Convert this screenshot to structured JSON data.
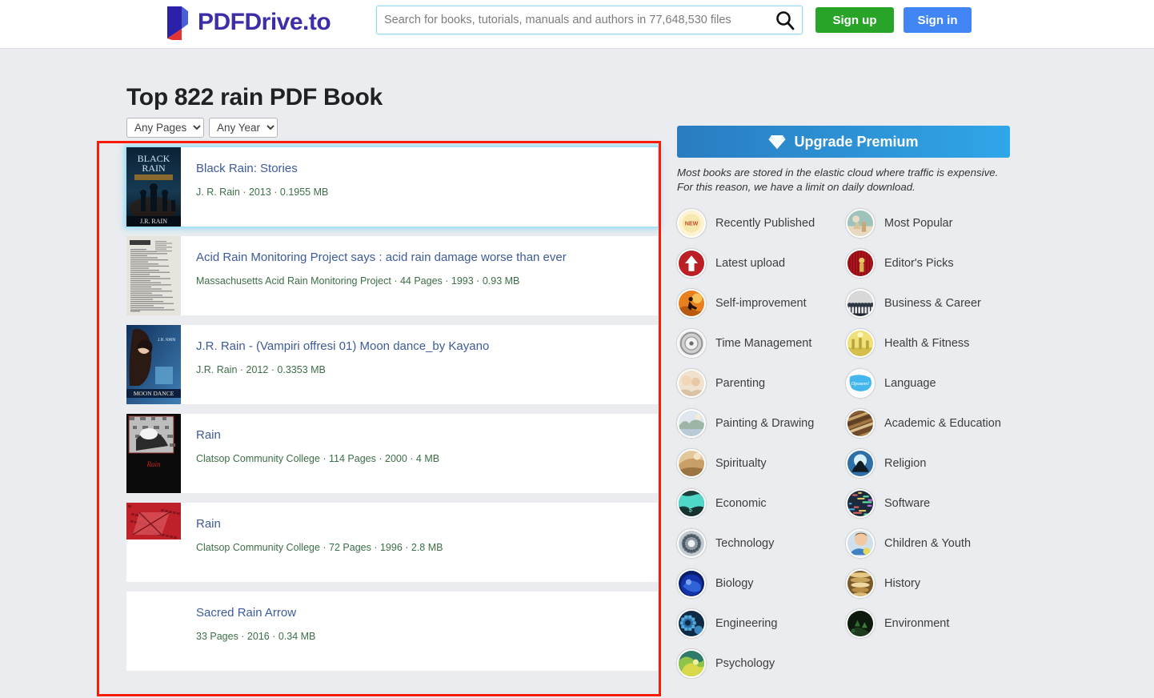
{
  "header": {
    "logo_text": "PDFDrive.to",
    "search": {
      "placeholder": "Search for books, tutorials, manuals and authors in 77,648,530 files",
      "value": "",
      "icon": "search-icon"
    },
    "signup_label": "Sign up",
    "signin_label": "Sign in",
    "signup_color": "#28a428",
    "signin_color": "#4285f4"
  },
  "main": {
    "page_title": "Top 822 rain PDF Book",
    "filters": [
      {
        "name": "pages",
        "selected": "Any Pages"
      },
      {
        "name": "year",
        "selected": "Any Year"
      }
    ],
    "results": [
      {
        "title": "Black Rain: Stories",
        "meta": "J. R. Rain · 2013 · 0.1955 MB",
        "author": "J. R. Rain",
        "year": "2013",
        "size": "0.1955 MB",
        "pages": "",
        "has_thumb": true,
        "thumb": "black-rain-cover",
        "highlighted": true
      },
      {
        "title": "Acid Rain Monitoring Project says : acid rain damage worse than ever",
        "meta": "Massachusetts Acid Rain Monitoring Project · 44 Pages · 1993 · 0.93 MB",
        "author": "Massachusetts Acid Rain Monitoring Project",
        "year": "1993",
        "size": "0.93 MB",
        "pages": "44 Pages",
        "has_thumb": true,
        "thumb": "document-scan-cover",
        "highlighted": false
      },
      {
        "title": "J.R. Rain - (Vampiri offresi 01) Moon dance_by Kayano",
        "meta": "J.R. Rain · 2012 · 0.3353 MB",
        "author": "J.R. Rain",
        "year": "2012",
        "size": "0.3353 MB",
        "pages": "",
        "has_thumb": true,
        "thumb": "moon-dance-cover",
        "highlighted": false
      },
      {
        "title": "Rain",
        "meta": "Clatsop Community College · 114 Pages · 2000 · 4 MB",
        "author": "Clatsop Community College",
        "year": "2000",
        "size": "4 MB",
        "pages": "114 Pages",
        "has_thumb": true,
        "thumb": "rain-bw-cover",
        "highlighted": false
      },
      {
        "title": "Rain",
        "meta": "Clatsop Community College · 72 Pages · 1996 · 2.8 MB",
        "author": "Clatsop Community College",
        "year": "1996",
        "size": "2.8 MB",
        "pages": "72 Pages",
        "has_thumb": true,
        "thumb": "rain-red-cover",
        "highlighted": false
      },
      {
        "title": "Sacred Rain Arrow",
        "meta": "33 Pages · 2016 · 0.34 MB",
        "author": "",
        "year": "2016",
        "size": "0.34 MB",
        "pages": "33 Pages",
        "has_thumb": false,
        "thumb": "",
        "highlighted": false
      }
    ]
  },
  "sidebar": {
    "upgrade_label": "Upgrade Premium",
    "upgrade_icon": "diamond-icon",
    "note": "Most books are stored in the elastic cloud where traffic is expensive. For this reason, we have a limit on daily download.",
    "categories": [
      {
        "label": "Recently Published",
        "icon": "new-badge-icon"
      },
      {
        "label": "Most Popular",
        "icon": "popular-hands-icon"
      },
      {
        "label": "Latest upload",
        "icon": "upload-arrow-icon"
      },
      {
        "label": "Editor's Picks",
        "icon": "theater-curtain-icon"
      },
      {
        "label": "Self-improvement",
        "icon": "running-person-icon"
      },
      {
        "label": "Business & Career",
        "icon": "business-crowd-icon"
      },
      {
        "label": "Time Management",
        "icon": "clock-icon"
      },
      {
        "label": "Health & Fitness",
        "icon": "fitness-icon"
      },
      {
        "label": "Parenting",
        "icon": "family-icon"
      },
      {
        "label": "Language",
        "icon": "speech-bubble-icon"
      },
      {
        "label": "Painting & Drawing",
        "icon": "painting-icon"
      },
      {
        "label": "Academic & Education",
        "icon": "books-stack-icon"
      },
      {
        "label": "Spiritualty",
        "icon": "spiritual-icon"
      },
      {
        "label": "Religion",
        "icon": "praying-hands-icon"
      },
      {
        "label": "Economic",
        "icon": "economy-globe-icon"
      },
      {
        "label": "Software",
        "icon": "code-screen-icon"
      },
      {
        "label": "Technology",
        "icon": "circuit-icon"
      },
      {
        "label": "Children & Youth",
        "icon": "child-icon"
      },
      {
        "label": "Biology",
        "icon": "cell-icon"
      },
      {
        "label": "History",
        "icon": "ancient-scroll-icon"
      },
      {
        "label": "Engineering",
        "icon": "gears-icon"
      },
      {
        "label": "Environment",
        "icon": "forest-icon"
      },
      {
        "label": "Psychology",
        "icon": "brain-icon"
      }
    ]
  },
  "annotation": {
    "box_color": "#fe1b06"
  }
}
